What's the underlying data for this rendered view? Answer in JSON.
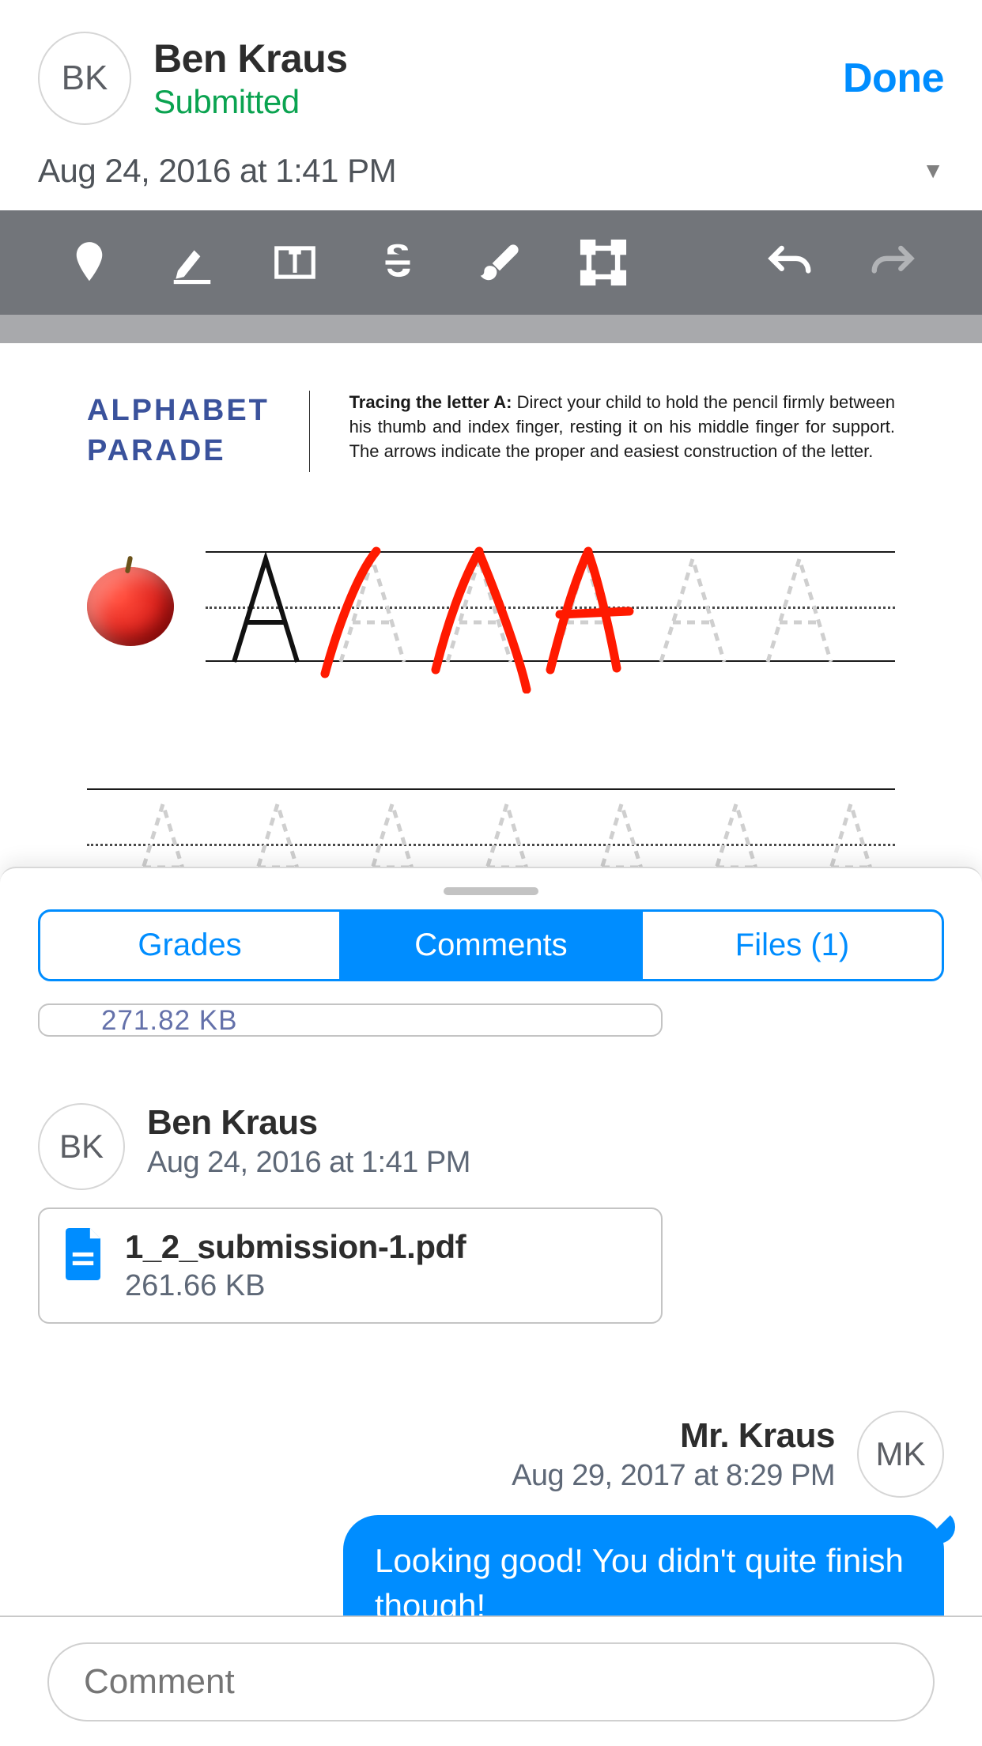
{
  "header": {
    "avatar_initials": "BK",
    "student_name": "Ben Kraus",
    "status": "Submitted",
    "done_label": "Done",
    "submission_timestamp": "Aug 24, 2016 at 1:41 PM"
  },
  "toolbar": {
    "tools": [
      "pin",
      "highlight",
      "text-box",
      "strike",
      "brush",
      "crop"
    ],
    "undo": "undo",
    "redo": "redo"
  },
  "document": {
    "title_line1": "ALPHABET",
    "title_line2": "PARADE",
    "instructions_bold": "Tracing the letter A:",
    "instructions_rest": "  Direct your child to hold the pencil firmly between his thumb and index finger, resting it on his middle finger for support.  The arrows indicate the proper and easiest construction of the letter."
  },
  "drawer": {
    "tabs": {
      "grades": "Grades",
      "comments": "Comments",
      "files": "Files (1)"
    },
    "active_tab": "comments",
    "partial_file_size": "271.82 KB",
    "comments": [
      {
        "type": "student",
        "avatar": "BK",
        "name": "Ben Kraus",
        "date": "Aug 24, 2016 at 1:41 PM",
        "attachment": {
          "file_name": "1_2_submission-1.pdf",
          "file_size": "261.66 KB"
        }
      },
      {
        "type": "teacher",
        "avatar": "MK",
        "name": "Mr. Kraus",
        "date": "Aug 29, 2017 at 8:29 PM",
        "text": "Looking good! You didn't quite finish though!"
      }
    ],
    "input_placeholder": "Comment"
  }
}
